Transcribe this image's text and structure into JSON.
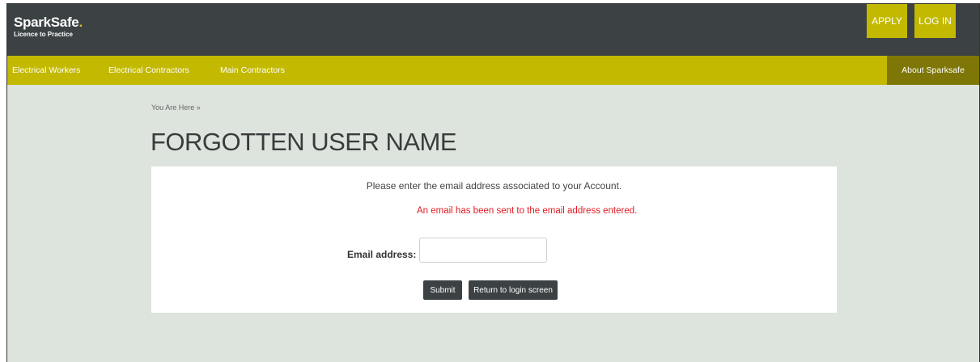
{
  "header": {
    "logo_name": "SparkSafe",
    "logo_dot": ".",
    "logo_tagline": "Licence to Practice",
    "apply_label": "APPLY",
    "login_label": "LOG IN"
  },
  "nav": {
    "items": [
      {
        "label": "Electrical Workers"
      },
      {
        "label": "Electrical Contractors"
      },
      {
        "label": "Main Contractors"
      }
    ],
    "about_label": "About Sparksafe"
  },
  "page": {
    "breadcrumb": "You Are Here »",
    "title": "FORGOTTEN USER NAME"
  },
  "form": {
    "instruction": "Please enter the email address associated to your Account.",
    "success_message": "An email has been sent to the email address entered.",
    "email_label": "Email address:",
    "email_value": "",
    "email_placeholder": "",
    "submit_label": "Submit",
    "return_label": "Return to login screen"
  },
  "colors": {
    "header_bg": "#3c4144",
    "accent": "#c2b900",
    "accent_dark": "#7e7708",
    "page_bg": "#dde3dd",
    "error_text": "#e01b22"
  }
}
